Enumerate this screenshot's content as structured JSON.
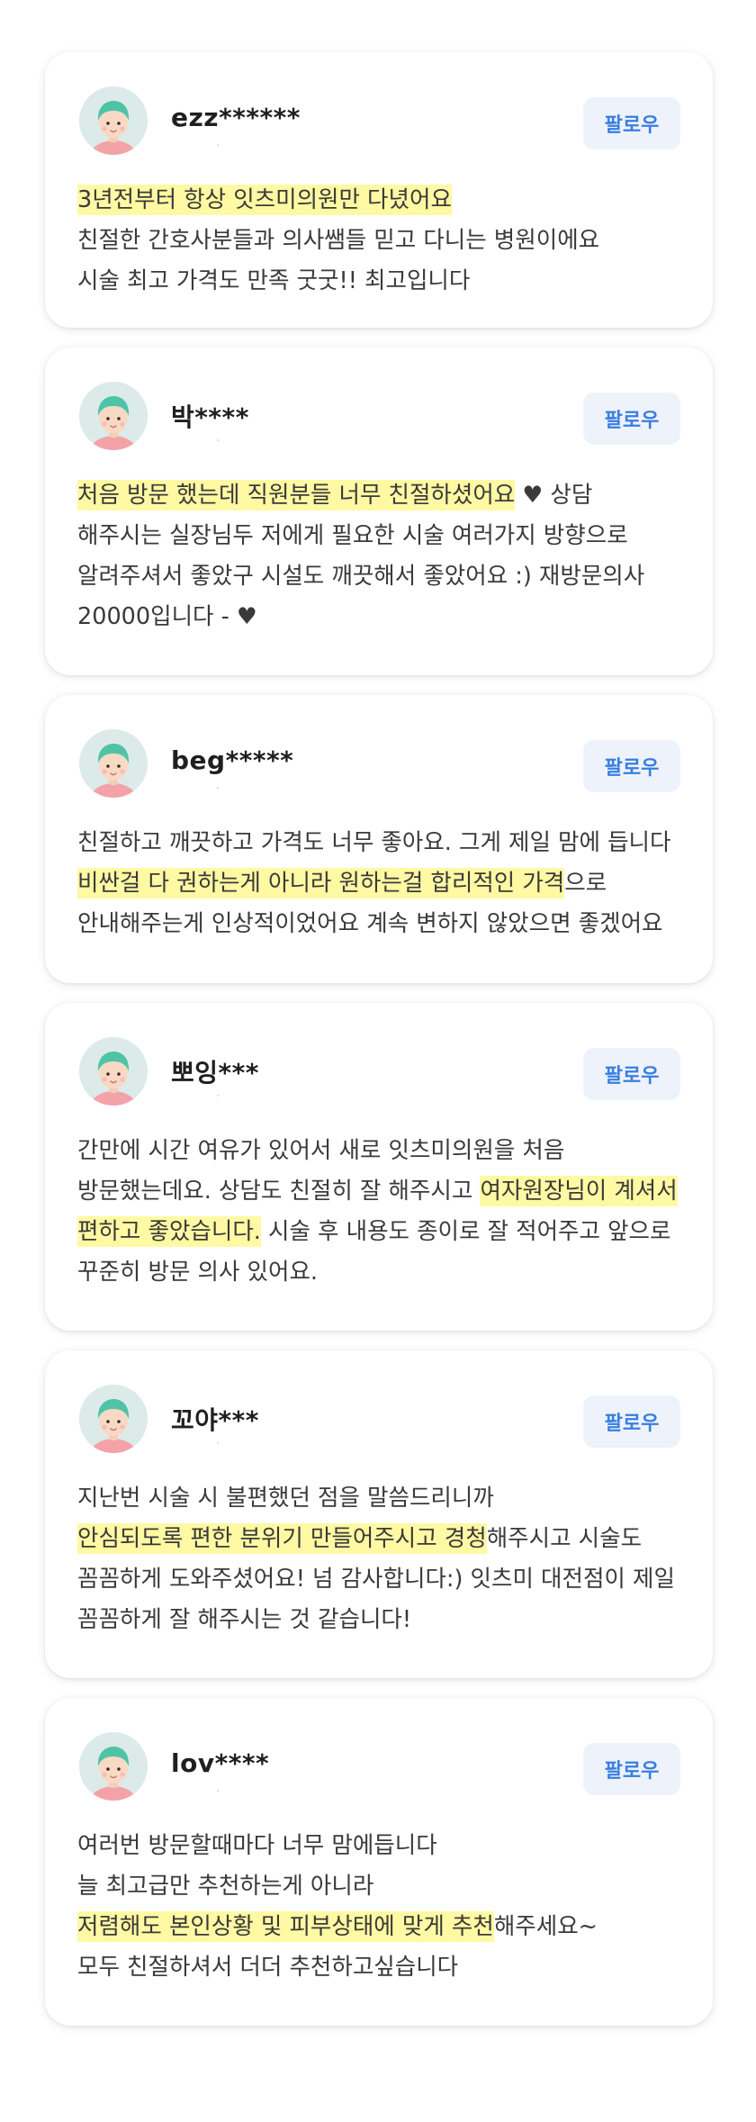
{
  "follow_label": "팔로우",
  "highlight_color": "#fff9a3",
  "accent_color": "#3a7ee0",
  "reviews": [
    {
      "nickname": "ezz******",
      "lines": [
        [
          {
            "t": "3년전부터 항상 잇츠미의원만 다녔어요",
            "h": true
          }
        ],
        [
          {
            "t": "친절한 간호사분들과 의사쌤들 믿고 다니는 병원이에요",
            "h": false
          }
        ],
        [
          {
            "t": "시술 최고 가격도 만족 굿굿!! 최고입니다",
            "h": false
          }
        ]
      ]
    },
    {
      "nickname": "박****",
      "lines": [
        [
          {
            "t": "처음 방문 했는데 직원분들 너무 친절하셨어요",
            "h": true
          },
          {
            "t": " ♥ 상담",
            "h": false
          }
        ],
        [
          {
            "t": "해주시는 실장님두 저에게 필요한 시술 여러가지 방향으로",
            "h": false
          }
        ],
        [
          {
            "t": "알려주셔서 좋았구 시설도 깨끗해서 좋았어요 :) 재방문의사",
            "h": false
          }
        ],
        [
          {
            "t": "20000입니다 - ♥",
            "h": false
          }
        ]
      ]
    },
    {
      "nickname": "beg*****",
      "lines": [
        [
          {
            "t": "친절하고 깨끗하고 가격도 너무 좋아요. 그게 제일 맘에 듭니다",
            "h": false
          }
        ],
        [
          {
            "t": "비싼걸 다 권하는게 아니라 원하는걸 합리적인 가격",
            "h": true
          },
          {
            "t": "으로",
            "h": false
          }
        ],
        [
          {
            "t": "안내해주는게 인상적이었어요 계속 변하지 않았으면 좋겠어요",
            "h": false
          }
        ]
      ]
    },
    {
      "nickname": "뽀잉***",
      "lines": [
        [
          {
            "t": "간만에 시간 여유가 있어서 새로 잇츠미의원을 처음",
            "h": false
          }
        ],
        [
          {
            "t": "방문했는데요. 상담도 친절히 잘 해주시고 ",
            "h": false
          },
          {
            "t": "여자원장님이 계셔서",
            "h": true
          }
        ],
        [
          {
            "t": "편하고 좋았습니다.",
            "h": true
          },
          {
            "t": " 시술 후 내용도 종이로 잘 적어주고 앞으로",
            "h": false
          }
        ],
        [
          {
            "t": "꾸준히 방문 의사 있어요.",
            "h": false
          }
        ]
      ]
    },
    {
      "nickname": "꼬야***",
      "lines": [
        [
          {
            "t": "지난번 시술 시 불편했던 점을 말씀드리니까",
            "h": false
          }
        ],
        [
          {
            "t": "안심되도록 편한 분위기 만들어주시고 경청",
            "h": true
          },
          {
            "t": "해주시고 시술도",
            "h": false
          }
        ],
        [
          {
            "t": "꼼꼼하게 도와주셨어요! 넘 감사합니다:) 잇츠미 대전점이 제일",
            "h": false
          }
        ],
        [
          {
            "t": "꼼꼼하게 잘 해주시는 것 같습니다!",
            "h": false
          }
        ]
      ]
    },
    {
      "nickname": "lov****",
      "lines": [
        [
          {
            "t": "여러번 방문할때마다 너무 맘에듭니다",
            "h": false
          }
        ],
        [
          {
            "t": "늘 최고급만 추천하는게 아니라",
            "h": false
          }
        ],
        [
          {
            "t": "저렴해도 본인상황 및 피부상태에 맞게 추천",
            "h": true
          },
          {
            "t": "해주세요~",
            "h": false
          }
        ],
        [
          {
            "t": "모두 친절하셔서 더더 추천하고싶습니다",
            "h": false
          }
        ]
      ]
    }
  ]
}
